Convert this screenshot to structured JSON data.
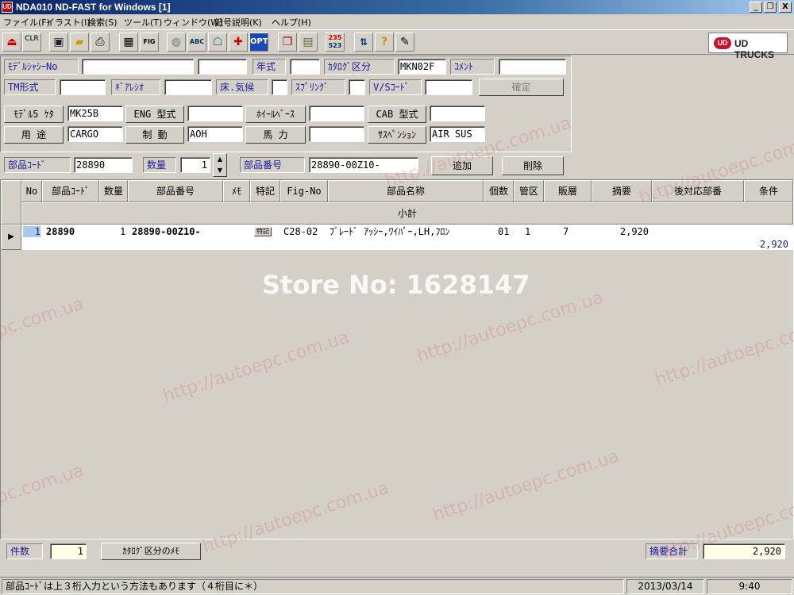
{
  "window": {
    "title": "NDA010 ND-FAST for Windows [1]",
    "app_icon": "UD",
    "minimize": "_",
    "restore": "❐",
    "close": "X"
  },
  "menu": [
    "ファイル(F)",
    "イラスト(I)",
    "検索(S)",
    "ツール(T)",
    "ウィンドウ(W)",
    "記号説明(K)",
    "ヘルプ(H)"
  ],
  "toolbar": {
    "clr": "CLR",
    "abc": "ABC",
    "fig": "FIG",
    "opt": "OPT",
    "nums_top": "235",
    "nums_bottom": "523",
    "icons": [
      "exit-icon",
      "clear-icon",
      "save-icon",
      "open-folder-icon",
      "print-icon",
      "grid-icon",
      "fig-icon",
      "globe-icon",
      "abc-icon",
      "image-icon",
      "medical-icon",
      "opt-icon",
      "book-icon",
      "clipboard-icon",
      "numbers-icon",
      "ln-icon",
      "help-icon",
      "pencil-icon"
    ],
    "brand": "UD TRUCKS",
    "brand_mark": "UD"
  },
  "form": {
    "model_chassis_no_label": "ﾓﾃﾞﾙｼｬｼｰNo",
    "model_chassis_no_value": "",
    "model_chassis_no_value2": "",
    "year_label": "年式",
    "year_value": "",
    "catalog_class_label": "ｶﾀﾛｸﾞ区分",
    "catalog_class_value": "MKN02F",
    "comment_label": "ｺﾒﾝﾄ",
    "comment_value": "",
    "tm_label": "TM形式",
    "tm_value": "",
    "gear_ratio_label": "ｷﾞｱﾚｼｵ",
    "gear_ratio_value": "",
    "floor_climate_label": "床.気候",
    "floor_climate_value": "",
    "spring_label": "ｽﾌﾟﾘﾝｸﾞ",
    "spring_value": "",
    "vs_code_label": "V/Sｺｰﾄﾞ",
    "vs_code_value": "",
    "confirm_button": "確定",
    "model5_label": "ﾓﾃﾞﾙ5 ｹﾀ",
    "model5_value": "MK25B",
    "eng_label": "ENG 型式",
    "eng_value": "",
    "wheelbase_label": "ﾎｲｰﾙﾍﾞｰｽ",
    "wheelbase_value": "",
    "cab_label": "CAB 型式",
    "cab_value": "",
    "usage_label": "用 途",
    "usage_value": "CARGO",
    "brake_label": "制 動",
    "brake_value": "AOH",
    "horsepower_label": "馬 力",
    "horsepower_value": "",
    "suspension_label": "ｻｽﾍﾟﾝｼｮﾝ",
    "suspension_value": "AIR SUS"
  },
  "entry": {
    "part_code_label": "部品ｺｰﾄﾞ",
    "part_code_value": "28890",
    "qty_label": "数量",
    "qty_value": "1",
    "part_no_label": "部品番号",
    "part_no_value": "28890-00Z10-",
    "add_button": "追加",
    "delete_button": "削除"
  },
  "grid": {
    "columns": [
      "No",
      "部品ｺｰﾄﾞ",
      "数量",
      "部品番号",
      "ﾒﾓ",
      "特記",
      "Fig-No",
      "部品名称",
      "個数",
      "管区",
      "販層",
      "摘要",
      "後対応部番",
      "条件"
    ],
    "subtotal_header": "小計",
    "row_indicator": "▶",
    "rows": [
      {
        "no": "1",
        "part_code": "28890",
        "qty": "1",
        "part_no": "28890-00Z10-",
        "memo": "",
        "note": "特記",
        "fig_no": "C28-02",
        "part_name": "ﾌﾞﾚｰﾄﾞ ｱｯｼｰ,ﾜｲﾊﾟｰ,LH,ﾌﾛﾝ",
        "count": "01",
        "district": "1",
        "sales_layer": "7",
        "summary": "2,920",
        "subtotal": "2,920"
      }
    ]
  },
  "watermarks": {
    "store": "Store No: 1628147",
    "site": "http://autoepc.com.ua",
    "site_short": "epc.com.ua"
  },
  "footer": {
    "count_label": "件数",
    "count_value": "1",
    "catalog_memo_button": "ｶﾀﾛｸﾞ区分のﾒﾓ",
    "summary_total_label": "摘要合計",
    "summary_total_value": "2,920"
  },
  "status": {
    "hint": "部品ｺｰﾄﾞは上３桁入力という方法もあります（４桁目に＊）",
    "date": "2013/03/14",
    "time": "9:40"
  }
}
